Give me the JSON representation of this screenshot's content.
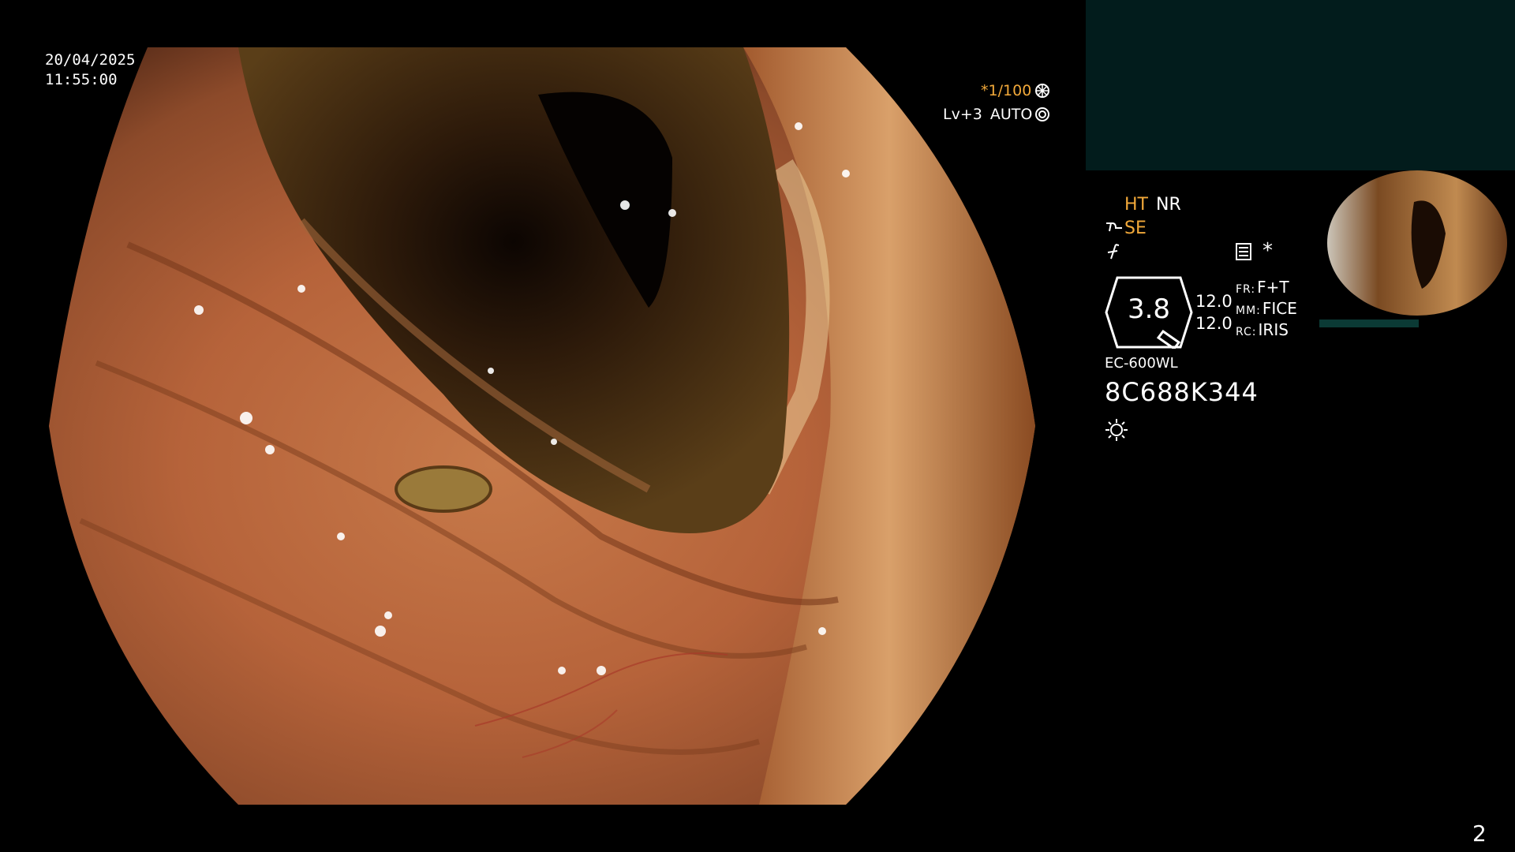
{
  "datetime": {
    "date": "20/04/2025",
    "time": "11:55:00"
  },
  "shutter": {
    "speed": "*1/100",
    "level": "Lv+3",
    "mode": "AUTO"
  },
  "status": {
    "ht": "HT",
    "nr": "NR",
    "se": "SE"
  },
  "zoom": {
    "value": "3.8",
    "line1": "12.0",
    "line2": "12.0",
    "fr_label": "FR:",
    "fr_value": "F+T",
    "mm_label": "MM:",
    "mm_value": "FICE",
    "rc_label": "RC:",
    "rc_value": "IRIS"
  },
  "device": {
    "model": "EC-600WL",
    "serial": "8C688K344"
  },
  "page_number": "2",
  "colors": {
    "accent": "#f2a93a",
    "panel": "#021c1c",
    "text": "#ffffff"
  },
  "icons": [
    "aperture-icon",
    "auto-iris-icon",
    "scope-icon",
    "flash-icon",
    "settings-icon",
    "light-icon"
  ]
}
